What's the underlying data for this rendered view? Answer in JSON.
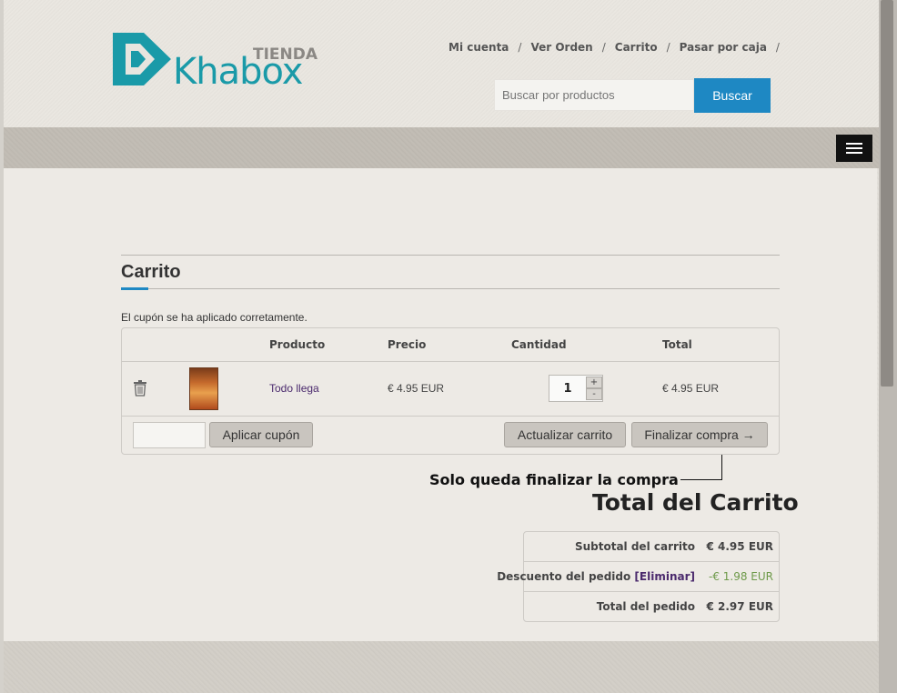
{
  "brand": {
    "name": "Khabox",
    "tagline": "TIENDA",
    "primary_color": "#1a9aa8",
    "accent_color": "#1e88c3"
  },
  "topnav": {
    "items": [
      {
        "label": "Mi cuenta"
      },
      {
        "label": "Ver Orden"
      },
      {
        "label": "Carrito"
      },
      {
        "label": "Pasar por caja"
      }
    ],
    "separator": "/"
  },
  "search": {
    "placeholder": "Buscar por productos",
    "button_label": "Buscar"
  },
  "menu_toggle_icon": "hamburger-icon",
  "cart": {
    "title": "Carrito",
    "message": "El cupón se ha aplicado corretamente.",
    "columns": [
      "Producto",
      "Precio",
      "Cantidad",
      "Total"
    ],
    "items": [
      {
        "product": "Todo llega",
        "price": "€ 4.95 EUR",
        "quantity": "1",
        "total": "€ 4.95 EUR"
      }
    ],
    "qty_plus": "+",
    "qty_minus": "-",
    "apply_coupon_label": "Aplicar cupón",
    "update_cart_label": "Actualizar carrito",
    "checkout_label": "Finalizar compra →"
  },
  "annotation": "Solo queda finalizar la compra",
  "totals": {
    "title": "Total del Carrito",
    "subtotal_label": "Subtotal del carrito",
    "subtotal_value": "€ 4.95 EUR",
    "discount_label": "Descuento del pedido",
    "discount_remove": "[Eliminar]",
    "discount_value": "-€ 1.98 EUR",
    "total_label": "Total del pedido",
    "total_value": "€ 2.97 EUR"
  }
}
